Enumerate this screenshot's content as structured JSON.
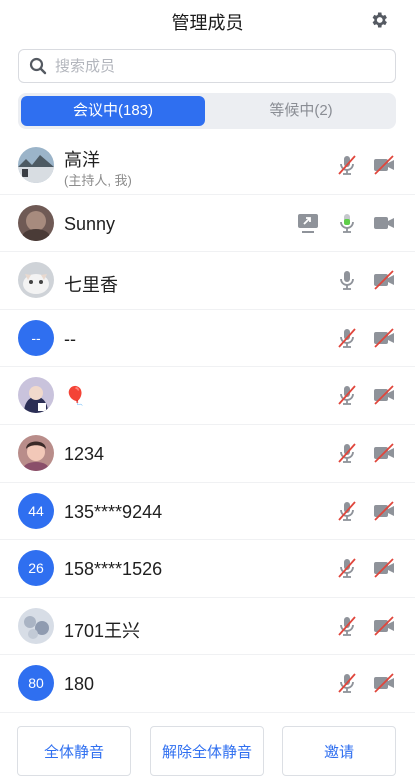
{
  "header": {
    "title": "管理成员"
  },
  "search": {
    "placeholder": "搜索成员"
  },
  "tabs": {
    "active": "会议中(183)",
    "inactive": "等候中(2)"
  },
  "members": [
    {
      "name": "高洋",
      "sub": "(主持人, 我)",
      "avatar": "photo-landscape",
      "mic": "muted",
      "cam": "off"
    },
    {
      "name": "Sunny",
      "sub": "",
      "avatar": "photo-face",
      "mic": "active",
      "cam": "on",
      "sharing": true
    },
    {
      "name": "七里香",
      "sub": "",
      "avatar": "photo-cat",
      "mic": "on",
      "cam": "off"
    },
    {
      "name": "--",
      "sub": "",
      "avatar_text": "--",
      "mic": "muted",
      "cam": "off"
    },
    {
      "name": "🎈",
      "sub": "",
      "avatar": "photo-person",
      "mic": "muted",
      "cam": "off"
    },
    {
      "name": "1234",
      "sub": "",
      "avatar": "photo-child",
      "mic": "muted",
      "cam": "off"
    },
    {
      "name": "135****9244",
      "sub": "",
      "avatar_text": "44",
      "mic": "muted",
      "cam": "off"
    },
    {
      "name": "158****1526",
      "sub": "",
      "avatar_text": "26",
      "mic": "muted",
      "cam": "off"
    },
    {
      "name": "1701王兴",
      "sub": "",
      "avatar": "photo-flower",
      "mic": "muted",
      "cam": "off"
    },
    {
      "name": "180",
      "sub": "",
      "avatar_text": "80",
      "mic": "muted",
      "cam": "off"
    }
  ],
  "actions": {
    "mute_all": "全体静音",
    "unmute_all": "解除全体静音",
    "invite": "邀请"
  },
  "colors": {
    "accent": "#2f6ff0",
    "muted_red": "#e0463c",
    "active_green": "#5fce4a",
    "icon_gray": "#8f939a"
  }
}
